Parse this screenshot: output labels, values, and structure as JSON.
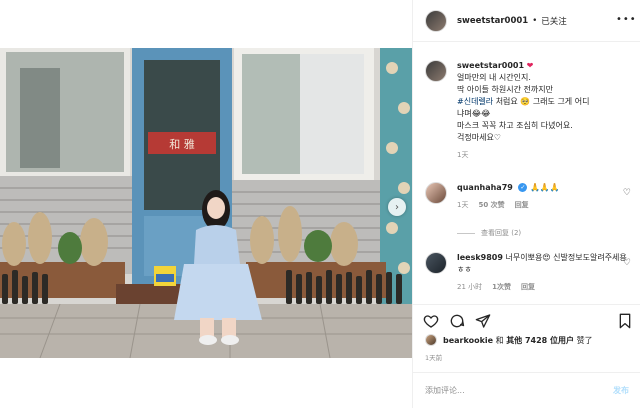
{
  "post": {
    "username": "sweetstar0001",
    "follow_label": "已关注",
    "caption_emoji": "❤",
    "caption_lines": [
      "얼마만의 내 시간인지.",
      "딱 아이들 하원시간 전까지만",
      "#신데렐라",
      " 처럼요 🥺 그래도 그게 어디",
      "냐며😂😂",
      "마스크 꼭꼭 차고 조심히 다녔어요.",
      "걱정마세요♡"
    ],
    "caption_time": "1天"
  },
  "comments": [
    {
      "username": "quanhaha79",
      "text": "🙏🙏🙏",
      "time": "1天",
      "likes": "50 次赞",
      "reply": "回复",
      "view_replies": "查看回复 (2)"
    },
    {
      "username": "leesk9809",
      "text": "너무이뽀용😍 신발정보도알려주세용 ㅎㅎ",
      "time": "21 小时",
      "likes": "1次赞",
      "reply": "回复"
    }
  ],
  "likes_row": {
    "first_user": "bearkookie",
    "connector": "和",
    "others": "其他 7428 位用户",
    "suffix": "赞了"
  },
  "post_time": "1天前",
  "add_comment": {
    "placeholder": "添加评论...",
    "post_label": "发布"
  },
  "colors": {
    "door": "#5b93b9",
    "verified": "#3897f0",
    "post_disabled": "#b2dffc",
    "tag": "#00376b"
  },
  "icons": [
    "more-icon",
    "heart-icon",
    "comment-icon",
    "share-icon",
    "bookmark-icon",
    "carousel-next-icon",
    "verified-icon"
  ]
}
